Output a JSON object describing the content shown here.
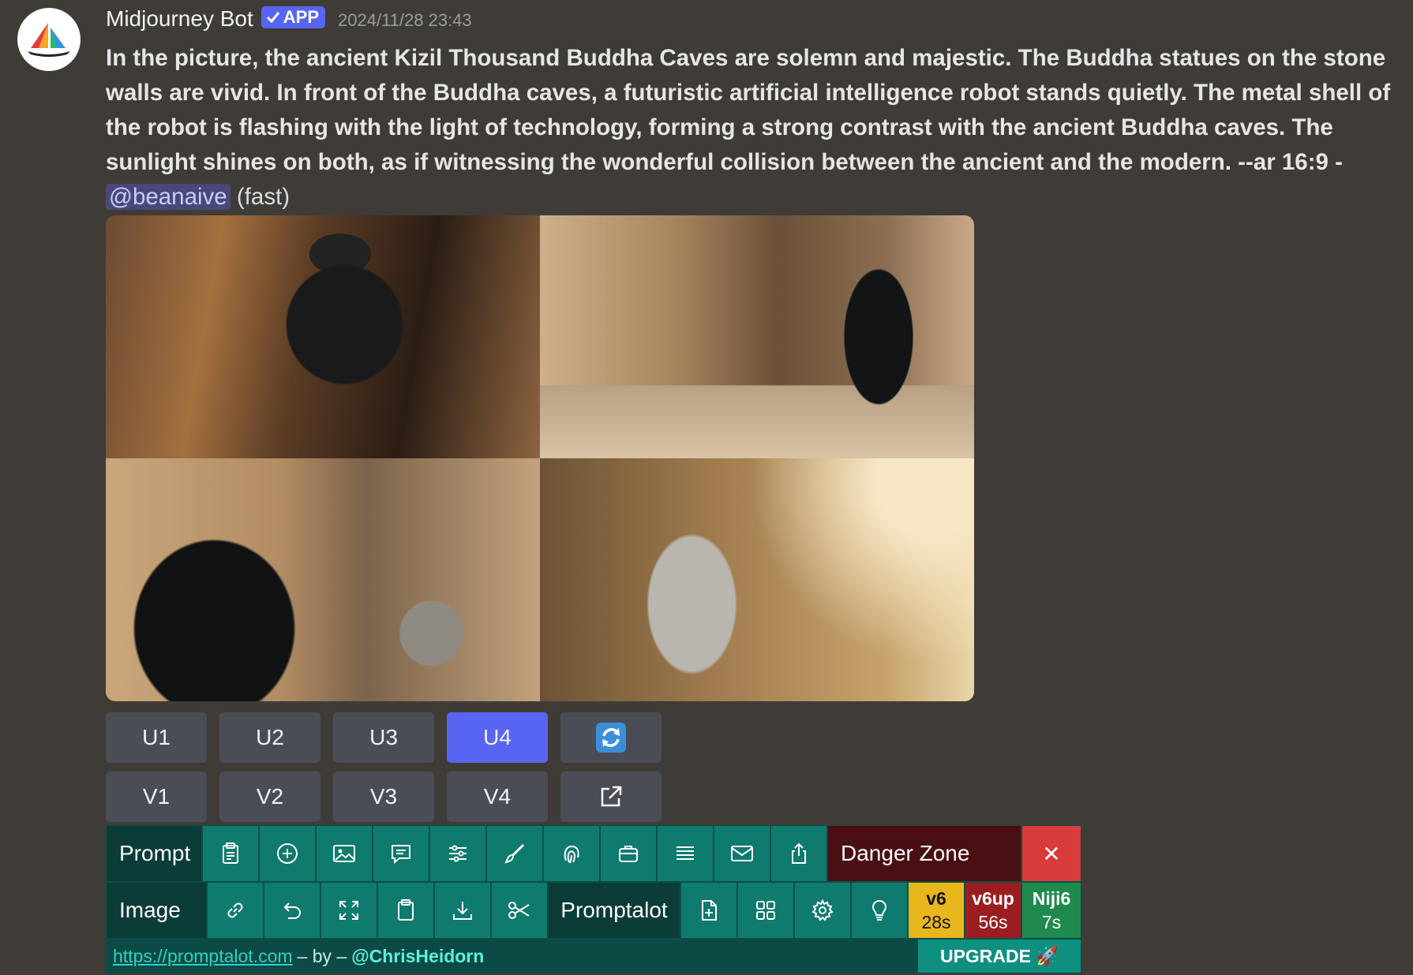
{
  "message": {
    "author": "Midjourney Bot",
    "badge": "APP",
    "timestamp": "2024/11/28 23:43",
    "prompt_text": "In the picture, the ancient Kizil Thousand Buddha Caves are solemn and majestic. The Buddha statues on the stone walls are vivid. In front of the Buddha caves, a futuristic artificial intelligence robot stands quietly. The metal shell of the robot is flashing with the light of technology, forming a strong contrast with the ancient Buddha caves. The sunlight shines on both, as if witnessing the wonderful collision between the ancient and the modern. --ar 16:9 -",
    "mention": "@beanaive",
    "speed": "(fast)"
  },
  "images": [
    {
      "name": "robot-cave-image-1"
    },
    {
      "name": "robot-cave-image-2"
    },
    {
      "name": "robot-cave-image-3"
    },
    {
      "name": "robot-cave-image-4"
    }
  ],
  "upscale_buttons": [
    "U1",
    "U2",
    "U3",
    "U4"
  ],
  "variation_buttons": [
    "V1",
    "V2",
    "V3",
    "V4"
  ],
  "active_button": "U4",
  "toolbar": {
    "prompt_label": "Prompt",
    "image_label": "Image",
    "promptalot_label": "Promptalot",
    "danger_label": "Danger Zone",
    "close_glyph": "✕",
    "row1_icons": [
      "clipboard-list-icon",
      "plus-circle-icon",
      "image-icon",
      "chat-icon",
      "sliders-icon",
      "brush-icon",
      "fingerprint-icon",
      "briefcase-icon",
      "lines-icon",
      "mail-icon",
      "share-icon"
    ],
    "row2_icons_a": [
      "link-icon",
      "undo-icon",
      "expand-icon",
      "clipboard-icon",
      "download-icon",
      "scissors-icon"
    ],
    "row2_icons_b": [
      "file-plus-icon",
      "grid-icon",
      "gear-icon",
      "lightbulb-icon"
    ],
    "models": [
      {
        "name": "v6",
        "time": "28s"
      },
      {
        "name": "v6up",
        "time": "56s"
      },
      {
        "name": "Niji6",
        "time": "7s"
      }
    ]
  },
  "footer": {
    "link": "https://promptalot.com",
    "by_text": "– by –",
    "handle": "@ChrisHeidorn",
    "upgrade": "UPGRADE 🚀"
  }
}
